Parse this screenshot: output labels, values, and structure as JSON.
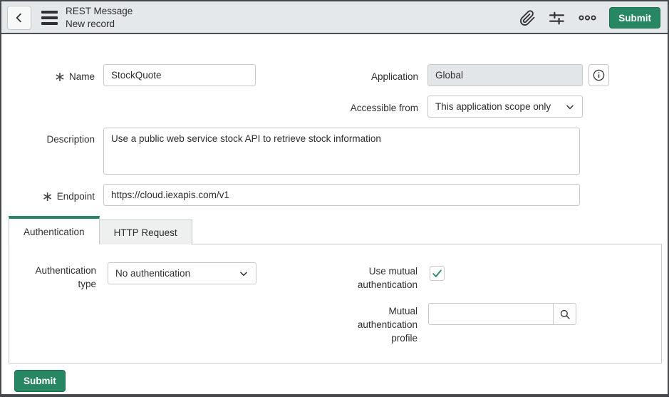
{
  "header": {
    "title": "REST Message",
    "subtitle": "New record",
    "submit_label": "Submit",
    "icons": {
      "back": "chevron-left",
      "menu": "hamburger",
      "attachments": "paperclip",
      "personalize": "sliders",
      "more": "more-options"
    }
  },
  "required_indicator": "∗",
  "form": {
    "name": {
      "label": "Name",
      "value": "StockQuote",
      "required": true
    },
    "application": {
      "label": "Application",
      "value": "Global",
      "readonly": true
    },
    "accessible_from": {
      "label": "Accessible from",
      "value": "This application scope only"
    },
    "description": {
      "label": "Description",
      "value": "Use a public web service stock API to retrieve stock information"
    },
    "endpoint": {
      "label": "Endpoint",
      "value": "https://cloud.iexapis.com/v1",
      "required": true
    }
  },
  "tabs": {
    "authentication": {
      "label": "Authentication",
      "active": true
    },
    "http_request": {
      "label": "HTTP Request",
      "active": false
    }
  },
  "authentication_section": {
    "authentication_type": {
      "label": "Authentication type",
      "value": "No authentication"
    },
    "use_mutual_authentication": {
      "label": "Use mutual authentication",
      "checked": true
    },
    "mutual_authentication_profile": {
      "label": "Mutual authentication profile",
      "value": ""
    }
  },
  "footer": {
    "submit_label": "Submit"
  },
  "colors": {
    "primary_green": "#278763",
    "header_bg": "#e5e8ea",
    "control_border": "#c6c8ca",
    "text": "#2e2e2e",
    "readonly_bg": "#e3e6e8",
    "tab_inactive_bg": "#eeefef",
    "page_border": "#45494d"
  }
}
